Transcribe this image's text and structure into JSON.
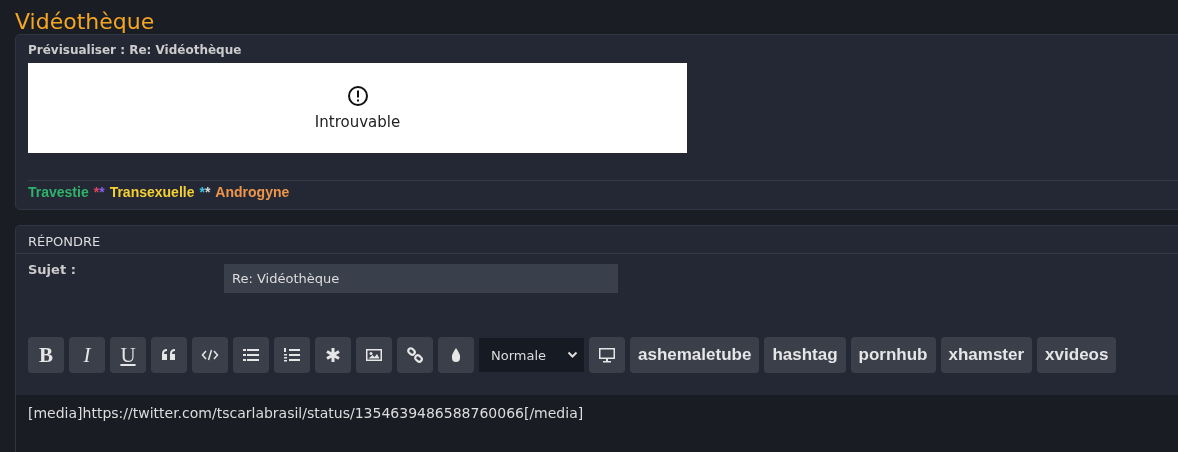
{
  "page_title": "Vidéothèque",
  "preview": {
    "label": "Prévisualiser : Re: Vidéothèque",
    "embed": {
      "message": "Introuvable"
    },
    "signature": [
      {
        "kind": "word",
        "text": "Travestie",
        "color": "#2fb36b"
      },
      {
        "kind": "star",
        "text": "*",
        "color": "#e0465a"
      },
      {
        "kind": "star",
        "text": "*",
        "color": "#8a5cf0"
      },
      {
        "kind": "word",
        "text": "Transexuelle",
        "color": "#f5d033"
      },
      {
        "kind": "star",
        "text": "*",
        "color": "#3cc8e6"
      },
      {
        "kind": "star",
        "text": "*",
        "color": "#d8d8d8"
      },
      {
        "kind": "word",
        "text": "Androgyne",
        "color": "#f0964a"
      }
    ]
  },
  "reply": {
    "heading": "RÉPONDRE",
    "subject_label": "Sujet :",
    "subject_value": "Re: Vidéothèque",
    "toolbar": [
      {
        "kind": "bold",
        "label": "B"
      },
      {
        "kind": "italic",
        "label": "I"
      },
      {
        "kind": "underline",
        "label": "U"
      },
      {
        "kind": "quote"
      },
      {
        "kind": "code"
      },
      {
        "kind": "list"
      },
      {
        "kind": "numbered"
      },
      {
        "kind": "asterisk"
      },
      {
        "kind": "image"
      },
      {
        "kind": "link"
      },
      {
        "kind": "drop"
      },
      {
        "kind": "select",
        "label": "Normale"
      },
      {
        "kind": "monitor"
      },
      {
        "kind": "tag",
        "label": "ashemaletube"
      },
      {
        "kind": "tag",
        "label": "hashtag"
      },
      {
        "kind": "tag",
        "label": "pornhub"
      },
      {
        "kind": "tag",
        "label": "xhamster"
      },
      {
        "kind": "tag",
        "label": "xvideos"
      }
    ],
    "message": "[media]https://twitter.com/tscarlabrasil/status/1354639486588760066[/media]"
  }
}
